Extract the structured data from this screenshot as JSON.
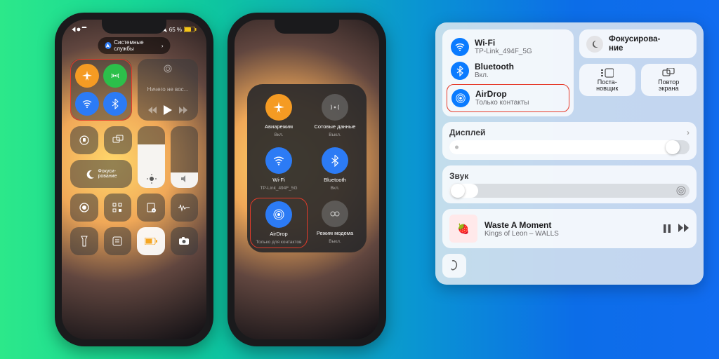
{
  "phone1": {
    "top_pill": "Системные службы",
    "battery_text": "65 %",
    "media_title": "Ничего не вос...",
    "focus_label": "Фокуси-\nрование"
  },
  "phone2": {
    "items": [
      {
        "label": "Авиарежим",
        "sub": "Вкл."
      },
      {
        "label": "Сотовые данные",
        "sub": "Выкл."
      },
      {
        "label": "Wi-Fi",
        "sub": "TP-Link_494F_5G"
      },
      {
        "label": "Bluetooth",
        "sub": "Вкл."
      },
      {
        "label": "AirDrop",
        "sub": "Только для контактов"
      },
      {
        "label": "Режим модема",
        "sub": "Выкл."
      }
    ]
  },
  "mac": {
    "wifi": {
      "title": "Wi-Fi",
      "sub": "TP-Link_494F_5G"
    },
    "bluetooth": {
      "title": "Bluetooth",
      "sub": "Вкл."
    },
    "airdrop": {
      "title": "AirDrop",
      "sub": "Только контакты"
    },
    "focus": "Фокусирова-\nние",
    "stage": "Поста-\nновщик",
    "mirror": "Повтор\nэкрана",
    "display_label": "Дисплей",
    "sound_label": "Звук",
    "song_title": "Waste A Moment",
    "song_sub": "Kings of Leon – WALLS"
  }
}
